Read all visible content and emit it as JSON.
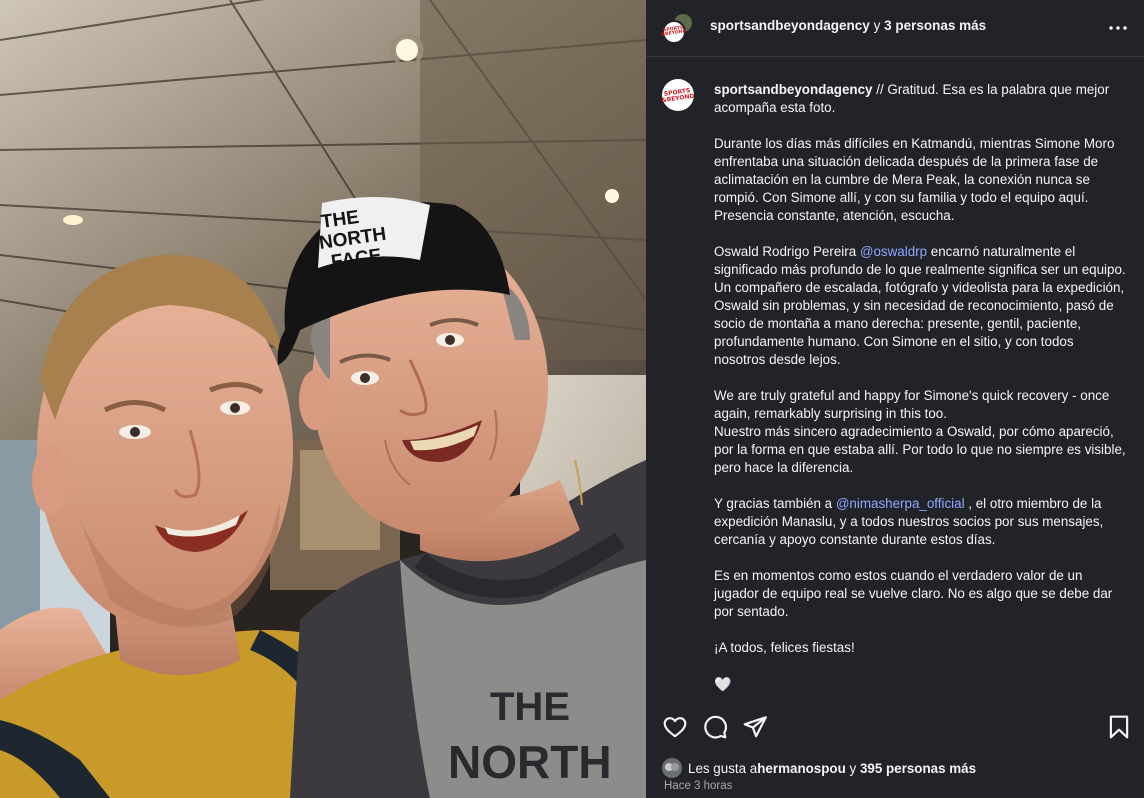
{
  "post": {
    "header_username": "sportsandbeyondagency",
    "header_connector": "y",
    "header_others": "3 personas más",
    "more_icon": "more-horizontal-icon"
  },
  "caption": {
    "username": "sportsandbeyondagency",
    "intro": " // Gratitud. Esa es la palabra que mejor acompaña esta foto.",
    "p1": "Durante los días más difíciles en Katmandú, mientras Simone Moro enfrentaba una situación delicada después de la primera fase de aclimatación en la cumbre de Mera Peak, la conexión nunca se rompió. Con Simone allí, y con su familia y todo el equipo aquí. Presencia constante, atención, escucha.",
    "p2_before": "Oswald Rodrigo Pereira ",
    "p2_mention": "@oswaldrp",
    "p2_after": " encarnó naturalmente el significado más profundo de lo que realmente significa ser un equipo. Un compañero de escalada, fotógrafo y videolista para la expedición, Oswald sin problemas, y sin necesidad de reconocimiento, pasó de socio de montaña a mano derecha: presente, gentil, paciente, profundamente humano. Con Simone en el sitio, y con todos nosotros desde lejos.",
    "p3_line1": "We are truly grateful and happy for Simone's quick recovery - once again, remarkably surprising in this too.",
    "p3_line2": "Nuestro más sincero agradecimiento a Oswald, por cómo apareció, por la forma en que estaba allí. Por todo lo que no siempre es visible, pero hace la diferencia.",
    "p4_before": "Y gracias también a ",
    "p4_mention": "@nimasherpa_official",
    "p4_after": " , el otro miembro de la expedición Manaslu, y a todos nuestros socios por sus mensajes, cercanía y apoyo constante durante estos días.",
    "p5": "Es en momentos como estos cuando el verdadero valor de un jugador de equipo real se vuelve claro. No es algo que se debe dar por sentado.",
    "p6": "¡A todos, felices fiestas!",
    "emoji": "🤍"
  },
  "logo": {
    "line1": "SPORTS",
    "line2": "&BEYOND",
    "color": "#d4202a"
  },
  "photo": {
    "cap_text_line1": "THE",
    "cap_text_line2": "NORTH",
    "cap_text_line3": "FACE",
    "shirt_text_line1": "THE",
    "shirt_text_line2": "NORTH"
  },
  "actions": {
    "like_icon": "heart-icon",
    "comment_icon": "comment-icon",
    "share_icon": "send-icon",
    "save_icon": "bookmark-icon"
  },
  "likes": {
    "prefix": "Les gusta a ",
    "user": "hermanospou",
    "connector": " y ",
    "count": "395 personas más"
  },
  "time": "Hace 3 horas",
  "colors": {
    "panel_bg": "#212328",
    "text": "#f5f5f5",
    "mention": "#8ea8ff",
    "muted": "#a8a8a8"
  }
}
